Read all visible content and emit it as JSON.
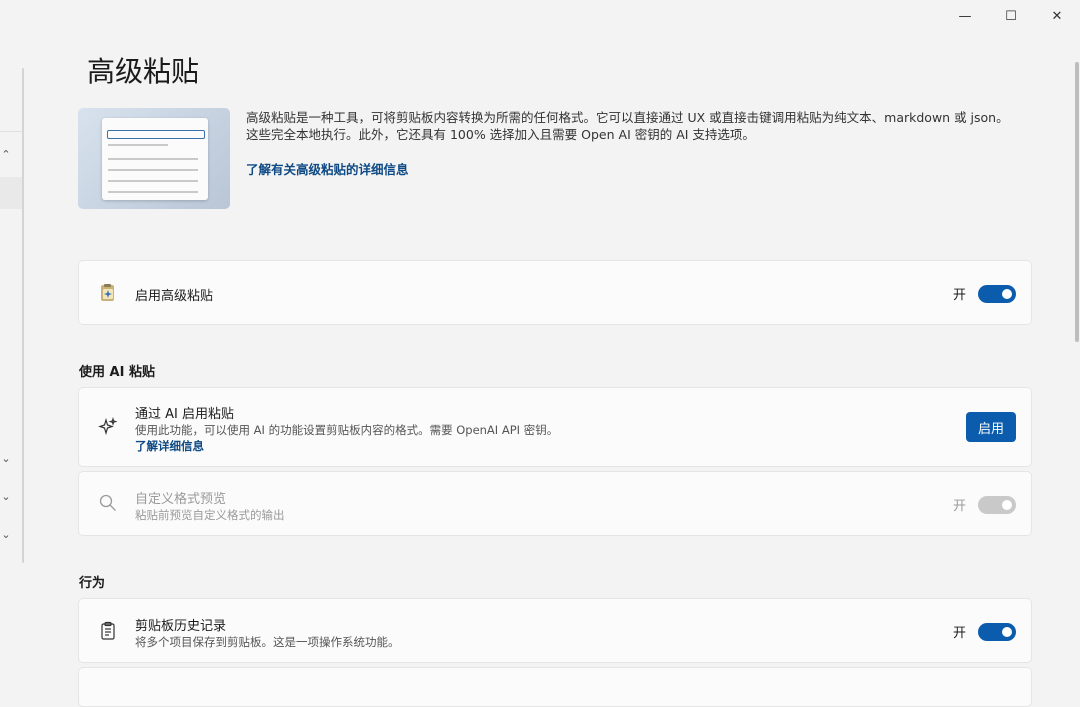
{
  "window": {
    "minimize": "—",
    "maximize": "☐",
    "close": "✕"
  },
  "page": {
    "title": "高级粘贴",
    "description": "高级粘贴是一种工具，可将剪贴板内容转换为所需的任何格式。它可以直接通过 UX 或直接击键调用粘贴为纯文本、markdown 或 json。这些完全本地执行。此外，它还具有 100% 选择加入且需要 Open AI 密钥的 AI 支持选项。",
    "learn_more": "了解有关高级粘贴的详细信息"
  },
  "enable_card": {
    "title": "启用高级粘贴",
    "toggle_label": "开",
    "on": true
  },
  "ai_section": {
    "header": "使用 AI 粘贴",
    "ai_card": {
      "title": "通过 AI 启用粘贴",
      "subtitle": "使用此功能，可以使用 AI 的功能设置剪贴板内容的格式。需要 OpenAI API 密钥。",
      "link": "了解详细信息",
      "button": "启用"
    },
    "custom_card": {
      "title": "自定义格式预览",
      "subtitle": "粘贴前预览自定义格式的输出",
      "toggle_label": "开",
      "on": true,
      "disabled": true
    }
  },
  "behavior_section": {
    "header": "行为",
    "clipboard_card": {
      "title": "剪贴板历史记录",
      "subtitle": "将多个项目保存到剪贴板。这是一项操作系统功能。",
      "toggle_label": "开",
      "on": true
    }
  },
  "nav": {
    "chevron_up": "⌃",
    "chevron_down": "⌄"
  },
  "colors": {
    "accent": "#0b5cad",
    "link": "#0f4a84",
    "card": "#fbfbfb",
    "background": "#f3f3f3"
  },
  "icons": [
    "paste-app-icon",
    "sparkle-icon",
    "search-icon",
    "clipboard-icon"
  ]
}
